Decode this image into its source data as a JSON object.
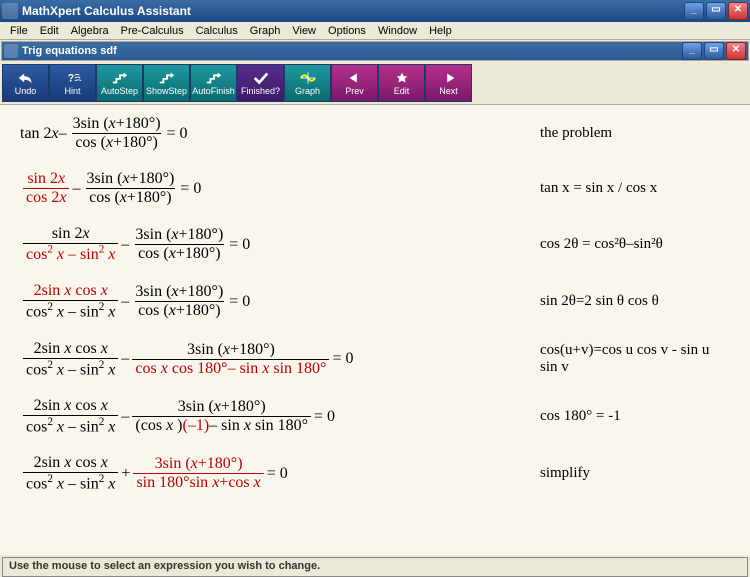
{
  "window": {
    "title": "MathXpert Calculus Assistant"
  },
  "menu": [
    "File",
    "Edit",
    "Algebra",
    "Pre-Calculus",
    "Calculus",
    "Graph",
    "View",
    "Options",
    "Window",
    "Help"
  ],
  "doc": {
    "title": "Trig equations  sdf"
  },
  "toolbar": [
    {
      "label": "Undo",
      "color": "blue",
      "icon": "undo"
    },
    {
      "label": "Hint",
      "color": "blue",
      "icon": "hint"
    },
    {
      "label": "AutoStep",
      "color": "teal",
      "icon": "step"
    },
    {
      "label": "ShowStep",
      "color": "teal",
      "icon": "step"
    },
    {
      "label": "AutoFinish",
      "color": "teal",
      "icon": "step"
    },
    {
      "label": "Finished?",
      "color": "purple",
      "icon": "check"
    },
    {
      "label": "Graph",
      "color": "teal",
      "icon": "graph"
    },
    {
      "label": "Prev",
      "color": "pink",
      "icon": "prev"
    },
    {
      "label": "Edit",
      "color": "pink",
      "icon": "star"
    },
    {
      "label": "Next",
      "color": "pink",
      "icon": "next"
    }
  ],
  "status": "Use the mouse to select an expression you wish to change.",
  "steps": [
    {
      "reason": "the problem"
    },
    {
      "reason": "tan x = sin x / cos x"
    },
    {
      "reason": "cos 2θ = cos²θ–sin²θ"
    },
    {
      "reason": "sin 2θ=2 sin θ cos θ"
    },
    {
      "reason": "cos(u+v)=cos u cos v - sin u sin v"
    },
    {
      "reason": "cos 180° = -1"
    },
    {
      "reason": "simplify"
    }
  ],
  "eq0": " = 0"
}
